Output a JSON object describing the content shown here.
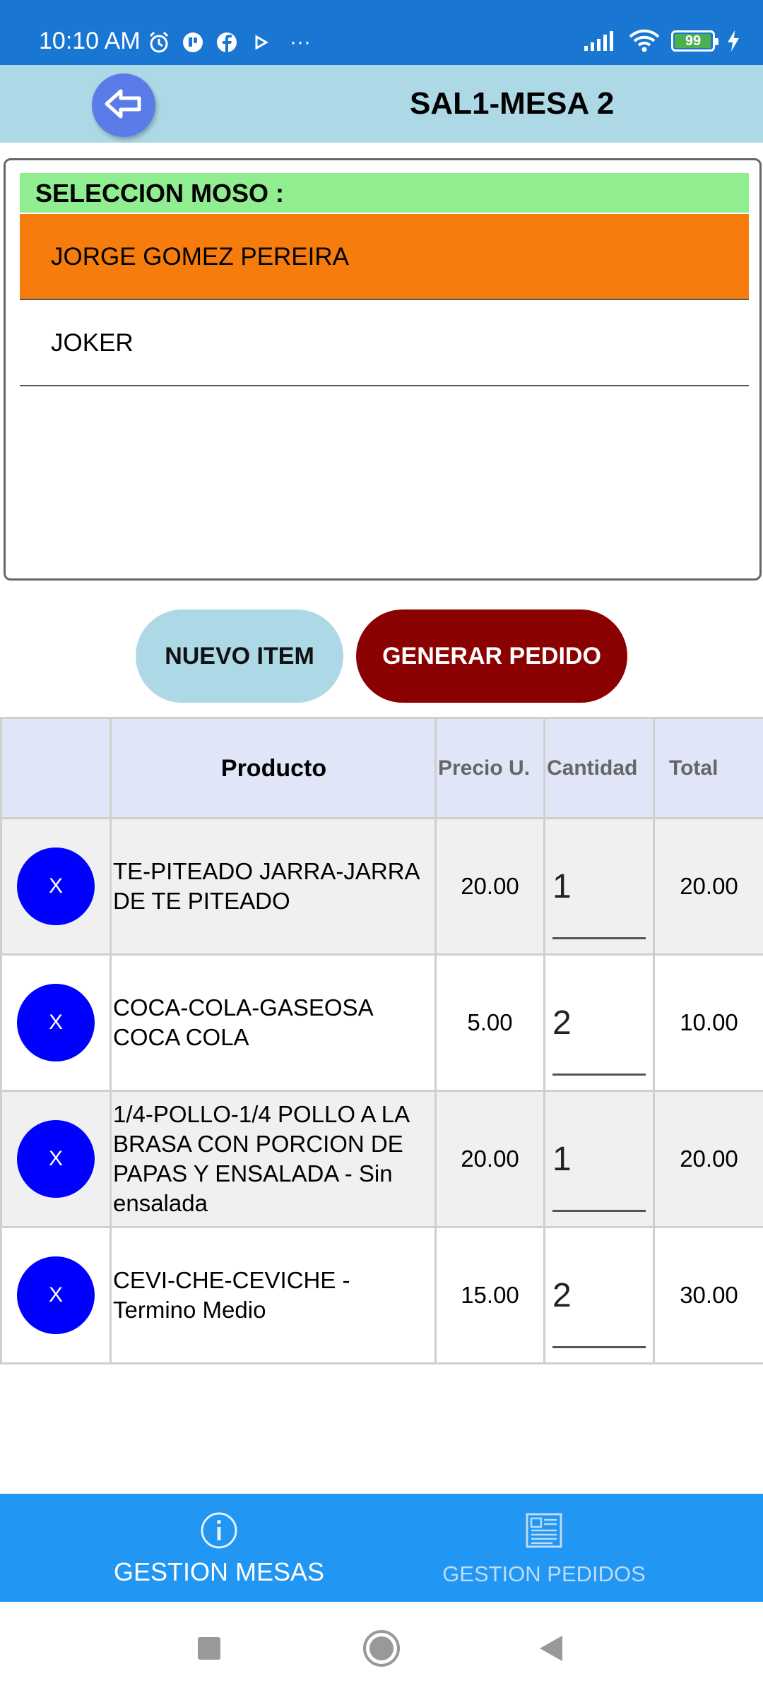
{
  "status_bar": {
    "time": "10:10 AM",
    "more": "···",
    "battery": "99",
    "battery_level": 0.99,
    "icons": [
      "alarm-icon",
      "messenger-icon",
      "facebook-icon",
      "play-icon",
      "signal-icon",
      "wifi-icon",
      "battery-icon",
      "charging-icon"
    ]
  },
  "header": {
    "title": "SAL1-MESA 2",
    "back_icon": "back-arrow-icon",
    "bg_color": "#add8e6"
  },
  "waiter_selection": {
    "heading": "SELECCION MOSO :",
    "items": [
      {
        "name": "JORGE GOMEZ PEREIRA",
        "selected": true
      },
      {
        "name": "JOKER",
        "selected": false
      }
    ],
    "selected_color": "#f57c0d",
    "heading_color": "#90ee90"
  },
  "actions": {
    "new_item": "NUEVO ITEM",
    "generate_order": "GENERAR PEDIDO"
  },
  "table": {
    "headers": {
      "product": "Producto",
      "unit_price": "Precio U.",
      "quantity": "Cantidad",
      "total": "Total"
    },
    "rows": [
      {
        "delete": "X",
        "product": "TE-PITEADO JARRA-JARRA DE TE PITEADO",
        "price": "20.00",
        "qty": "1",
        "total": "20.00"
      },
      {
        "delete": "X",
        "product": "COCA-COLA-GASEOSA COCA COLA",
        "price": "5.00",
        "qty": "2",
        "total": "10.00"
      },
      {
        "delete": "X",
        "product": "1/4-POLLO-1/4 POLLO A LA BRASA CON PORCION DE PAPAS Y ENSALADA - Sin ensalada",
        "price": "20.00",
        "qty": "1",
        "total": "20.00"
      },
      {
        "delete": "X",
        "product": "CEVI-CHE-CEVICHE - Termino Medio",
        "price": "15.00",
        "qty": "2",
        "total": "30.00"
      }
    ]
  },
  "bottom_nav": {
    "items": [
      {
        "label": "GESTION MESAS",
        "icon": "info-icon",
        "active": true
      },
      {
        "label": "GESTION PEDIDOS",
        "icon": "document-icon",
        "active": false
      }
    ]
  },
  "system_nav": {
    "icons": [
      "recents-icon",
      "home-icon",
      "back-icon"
    ]
  }
}
